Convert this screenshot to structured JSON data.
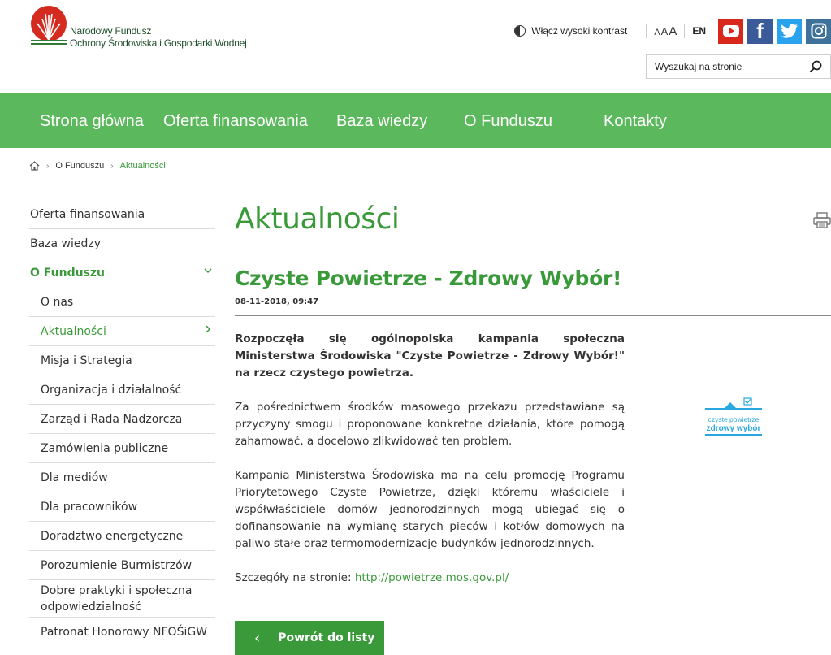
{
  "header": {
    "logo_line1": "Narodowy Fundusz",
    "logo_line2": "Ochrony Środowiska i Gospodarki Wodnej",
    "contrast_label": "Włącz wysoki kontrast",
    "font_size_labels": [
      "A",
      "A",
      "A"
    ],
    "lang_label": "EN",
    "social": [
      "youtube-icon",
      "facebook-icon",
      "twitter-icon",
      "instagram-icon"
    ],
    "search_placeholder": "Wyszukaj na stronie"
  },
  "nav": {
    "items": [
      "Strona główna",
      "Oferta finansowania",
      "Baza wiedzy",
      "O Funduszu",
      "Kontakty"
    ]
  },
  "breadcrumb": {
    "items": [
      "O Funduszu",
      "Aktualności"
    ]
  },
  "sidebar": {
    "top_items": [
      "Oferta finansowania",
      "Baza wiedzy",
      "O Funduszu"
    ],
    "sub_items": [
      "O nas",
      "Aktualności",
      "Misja i Strategia",
      "Organizacja i działalność",
      "Zarząd i Rada Nadzorcza",
      "Zamówienia publiczne",
      "Dla mediów",
      "Dla pracowników",
      "Doradztwo energetyczne",
      "Porozumienie Burmistrzów",
      "Dobre praktyki i społeczna odpowiedzialność",
      "Patronat Honorowy NFOŚiGW"
    ]
  },
  "main": {
    "page_title": "Aktualności",
    "article_title": "Czyste Powietrze - Zdrowy Wybór!",
    "article_date": "08-11-2018, 09:47",
    "lead": "Rozpoczęła się ogólnopolska kampania społeczna Ministerstwa Środowiska \"Czyste Powietrze - Zdrowy Wybór!\" na rzecz czystego powietrza.",
    "para1": "Za pośrednictwem środków masowego przekazu przedstawiane są przyczyny smogu i proponowane konkretne działania, które pomogą zahamować, a docelowo zlikwidować ten problem.",
    "para2": "Kampania Ministerstwa Środowiska ma na celu promocję Programu Priorytetowego Czyste Powietrze, dzięki któremu właściciele i współwłaściciele domów jednorodzinnych mogą ubiegać się o dofinansowanie na wymianę starych pieców i kotłów domowych na paliwo stałe oraz termomodernizację budynków jednorodzinnych.",
    "details_label": "Szczegóły na stronie: ",
    "details_link": "http://powietrze.mos.gov.pl/",
    "badge_line1": "czyste powietrze",
    "badge_line2": "zdrowy wybór",
    "back_label": "Powrót do listy"
  },
  "colors": {
    "brand_green": "#5cb85c",
    "text_green": "#3a9a3a"
  }
}
